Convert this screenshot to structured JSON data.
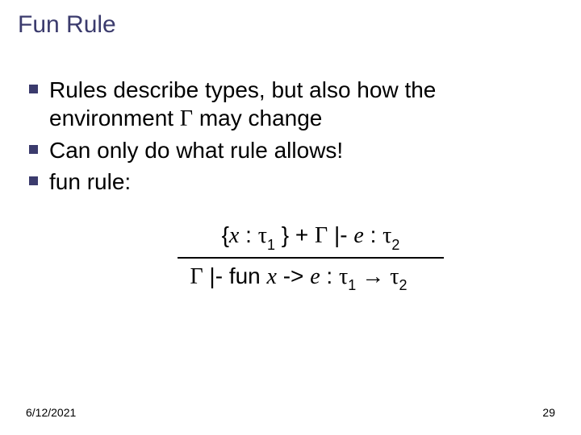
{
  "title": "Fun Rule",
  "bullets": [
    {
      "pre": "Rules describe types, but also how the environment ",
      "gamma": "Γ",
      "post": " may change"
    },
    {
      "text": " Can only do what rule allows!"
    },
    {
      "text": " fun rule:"
    }
  ],
  "rule": {
    "top": {
      "lbrace": "{",
      "x": "x",
      "colon1": " : ",
      "tau": "τ",
      "sub1": "1",
      "rbrace": " } + ",
      "gamma": "Γ",
      "turn": " |- ",
      "e": "e",
      "colon2": " : ",
      "tau2": "τ",
      "sub2": "2"
    },
    "bot": {
      "gamma": "Γ",
      "turn": " |- fun ",
      "x": "x",
      "arrow": " -> ",
      "e": "e",
      "colon": " : ",
      "tau1": "τ",
      "sub1": "1",
      "to": " → ",
      "tau2": "τ",
      "sub2": "2"
    }
  },
  "footer": {
    "date": "6/12/2021",
    "page": "29"
  }
}
